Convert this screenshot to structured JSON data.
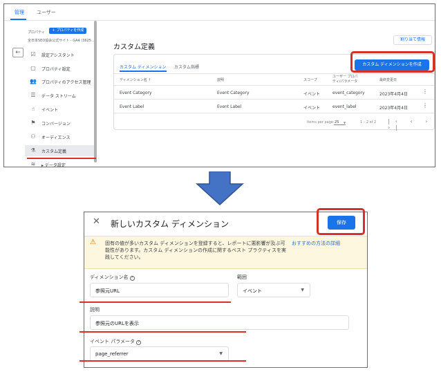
{
  "top": {
    "admin_tabs": [
      "管理",
      "ユーザー"
    ],
    "property_label": "プロパティ",
    "create_property_button": "＋ プロパティを作成",
    "property_name": "全日本SEO協会公式サイト - GA4 (3625...",
    "sidebar": [
      {
        "icon": "checklist-icon",
        "glyph": "☑",
        "label": "設定アシスタント"
      },
      {
        "icon": "property-settings-icon",
        "glyph": "▢",
        "label": "プロパティ設定"
      },
      {
        "icon": "access-management-icon",
        "glyph": "👥",
        "label": "プロパティのアクセス管理"
      },
      {
        "icon": "data-stream-icon",
        "glyph": "☰",
        "label": "データ ストリーム"
      },
      {
        "icon": "event-icon",
        "glyph": "☝",
        "label": "イベント"
      },
      {
        "icon": "conversion-flag-icon",
        "glyph": "⚑",
        "label": "コンバージョン"
      },
      {
        "icon": "audience-icon",
        "glyph": "⚇",
        "label": "オーディエンス"
      },
      {
        "icon": "custom-definitions-icon",
        "glyph": "⚗",
        "label": "カスタム定義"
      },
      {
        "icon": "data-settings-icon",
        "glyph": "≋",
        "label": "▸ データ設定"
      }
    ],
    "page_title": "カスタム定義",
    "quota_button": "割り当て情報",
    "card_tabs": [
      "カスタム ディメンション",
      "カスタム指標"
    ],
    "create_dimension_button": "カスタム ディメンションを作成",
    "table": {
      "headers": [
        "ディメンション名 ↑",
        "説明",
        "スコープ",
        "ユーザー プロパ\nティ/パラメータ",
        "最終変更日"
      ],
      "rows": [
        [
          "Event Category",
          "Event Category",
          "イベント",
          "event_category",
          "2023年4月4日"
        ],
        [
          "Event Label",
          "Event Label",
          "イベント",
          "event_label",
          "2023年4月4日"
        ]
      ],
      "items_per_page_label": "Items per page:",
      "items_per_page_value": "25",
      "range_text": "1 – 2 of 2",
      "pager_glyphs": "|‹ ‹ › ›|"
    }
  },
  "dialog": {
    "title": "新しいカスタム ディメンション",
    "save_button": "保存",
    "warning_text": "固有の値が多いカスタム ディメンションを登録すると、レポートに悪影響が及ぶ可能性があります。カスタム ディメンションの作成に関するベスト プラクティスを実践してください。",
    "warning_link": "おすすめの方法の詳細",
    "dimension_name_label": "ディメンション名",
    "dimension_name_value": "参照元URL",
    "scope_label": "範囲",
    "scope_value": "イベント",
    "description_label": "説明",
    "description_value": "参照元のURLを表示",
    "event_param_label": "イベント パラメータ",
    "event_param_value": "page_referrer"
  },
  "colors": {
    "accent_blue": "#1a73e8",
    "highlight_red": "#d93025",
    "arrow_blue": "#4472c4",
    "warning_bg": "#fef7e0"
  }
}
